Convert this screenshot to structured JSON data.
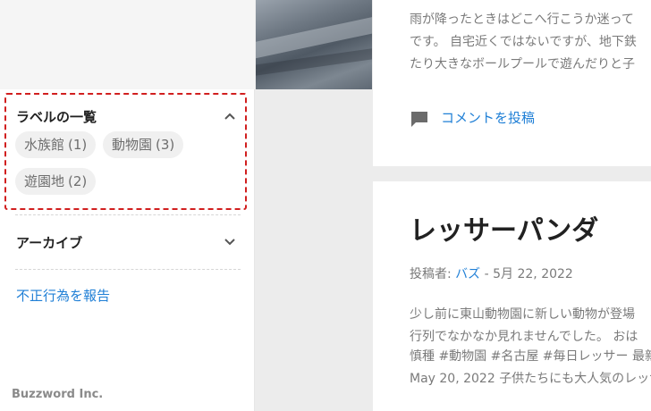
{
  "sidebar": {
    "labels_widget": {
      "title": "ラベルの一覧",
      "chips": [
        {
          "name": "水族館",
          "count": "(1)"
        },
        {
          "name": "動物園",
          "count": "(3)"
        },
        {
          "name": "遊園地",
          "count": "(2)"
        }
      ]
    },
    "archive_widget": {
      "title": "アーカイブ"
    },
    "report_link": "不正行為を報告",
    "footer_brand": "Buzzword Inc."
  },
  "post1": {
    "snippet_lines": [
      "雨が降ったときはどこへ行こうか迷って",
      "です。 自宅近くではないですが、地下鉄",
      "たり大きなボールプールで遊んだりと子"
    ],
    "comment_link": "コメントを投稿"
  },
  "post2": {
    "title": "レッサーパンダ",
    "byline_prefix": "投稿者: ",
    "author": "バズ",
    "byline_sep": " - ",
    "date": "5月 22, 2022",
    "snippet_lines": [
      "少し前に東山動物園に新しい動物が登場",
      "行列でなかなか見れませんでした。 おは",
      "慎種 #動物園 #名古屋 #毎日レッサー 最新",
      "May 20, 2022 子供たちにも大人気のレッサ"
    ]
  },
  "colors": {
    "link": "#1f7fd6",
    "highlight_border": "#d11f1f",
    "chip_bg": "#f0f0f0",
    "page_bg": "#ececec"
  },
  "icons": {
    "collapse": "chevron-up-icon",
    "expand": "chevron-down-icon",
    "comment": "comment-icon"
  }
}
